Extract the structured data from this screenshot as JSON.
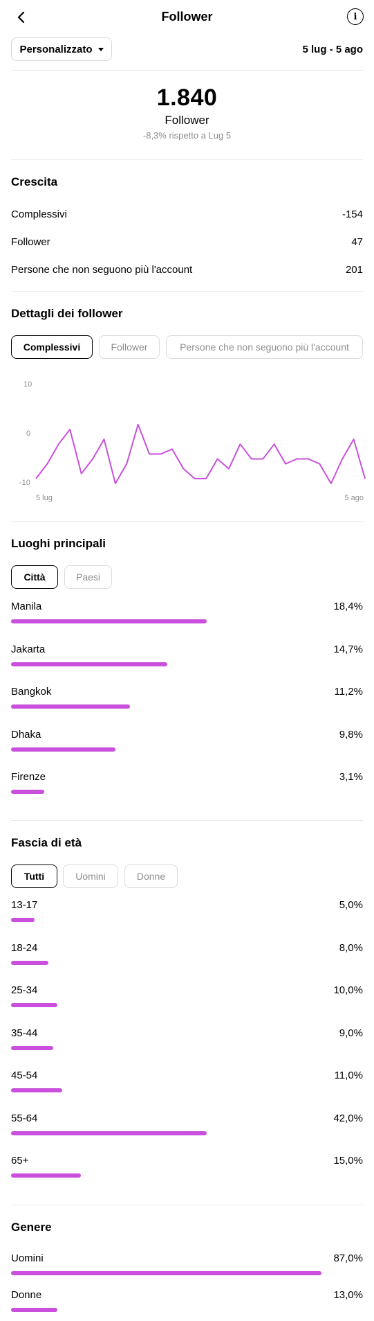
{
  "header": {
    "title": "Follower"
  },
  "filter": {
    "range_label": "Personalizzato",
    "date_range": "5 lug - 5 ago"
  },
  "summary": {
    "total": "1.840",
    "label": "Follower",
    "change": "-8,3% rispetto a Lug 5"
  },
  "growth": {
    "title": "Crescita",
    "rows": [
      {
        "label": "Complessivi",
        "value": "-154"
      },
      {
        "label": "Follower",
        "value": "47"
      },
      {
        "label": "Persone che non seguono più l'account",
        "value": "201"
      }
    ]
  },
  "details": {
    "title": "Dettagli dei follower",
    "tabs": [
      "Complessivi",
      "Follower",
      "Persone che non seguono più l'account"
    ],
    "active_tab": 0
  },
  "chart_data": {
    "type": "line",
    "x_labels": [
      "5 lug",
      "5 ago"
    ],
    "y_ticks": [
      10,
      0,
      -10
    ],
    "ylim": [
      -10,
      10
    ],
    "color": "#c94fdc",
    "values": [
      -9,
      -6,
      -2,
      1,
      -8,
      -5,
      -1,
      -10,
      -6,
      2,
      -4,
      -4,
      -3,
      -7,
      -9,
      -9,
      -5,
      -7,
      -2,
      -5,
      -5,
      -2,
      -6,
      -5,
      -5,
      -6,
      -10,
      -5,
      -1,
      -9
    ]
  },
  "locations": {
    "title": "Luoghi principali",
    "tabs": [
      "Città",
      "Paesi"
    ],
    "active_tab": 0,
    "items": [
      {
        "label": "Manila",
        "value": "18,4%",
        "fraction": 0.184
      },
      {
        "label": "Jakarta",
        "value": "14,7%",
        "fraction": 0.147
      },
      {
        "label": "Bangkok",
        "value": "11,2%",
        "fraction": 0.112
      },
      {
        "label": "Dhaka",
        "value": "9,8%",
        "fraction": 0.098
      },
      {
        "label": "Firenze",
        "value": "3,1%",
        "fraction": 0.031
      }
    ]
  },
  "age": {
    "title": "Fascia di età",
    "tabs": [
      "Tutti",
      "Uomini",
      "Donne"
    ],
    "active_tab": 0,
    "items": [
      {
        "label": "13-17",
        "value": "5,0%",
        "fraction": 0.05
      },
      {
        "label": "18-24",
        "value": "8,0%",
        "fraction": 0.08
      },
      {
        "label": "25-34",
        "value": "10,0%",
        "fraction": 0.1
      },
      {
        "label": "35-44",
        "value": "9,0%",
        "fraction": 0.09
      },
      {
        "label": "45-54",
        "value": "11,0%",
        "fraction": 0.11
      },
      {
        "label": "55-64",
        "value": "42,0%",
        "fraction": 0.42
      },
      {
        "label": "65+",
        "value": "15,0%",
        "fraction": 0.15
      }
    ]
  },
  "gender": {
    "title": "Genere",
    "items": [
      {
        "label": "Uomini",
        "value": "87,0%",
        "fraction": 0.87
      },
      {
        "label": "Donne",
        "value": "13,0%",
        "fraction": 0.13
      }
    ]
  },
  "colors": {
    "accent": "#c94fdc",
    "muted": "#8e8e8e",
    "divider": "#ececec"
  },
  "icons": {
    "back": "chevron-left-icon",
    "info": "info-icon",
    "dropdown": "caret-down-icon"
  }
}
